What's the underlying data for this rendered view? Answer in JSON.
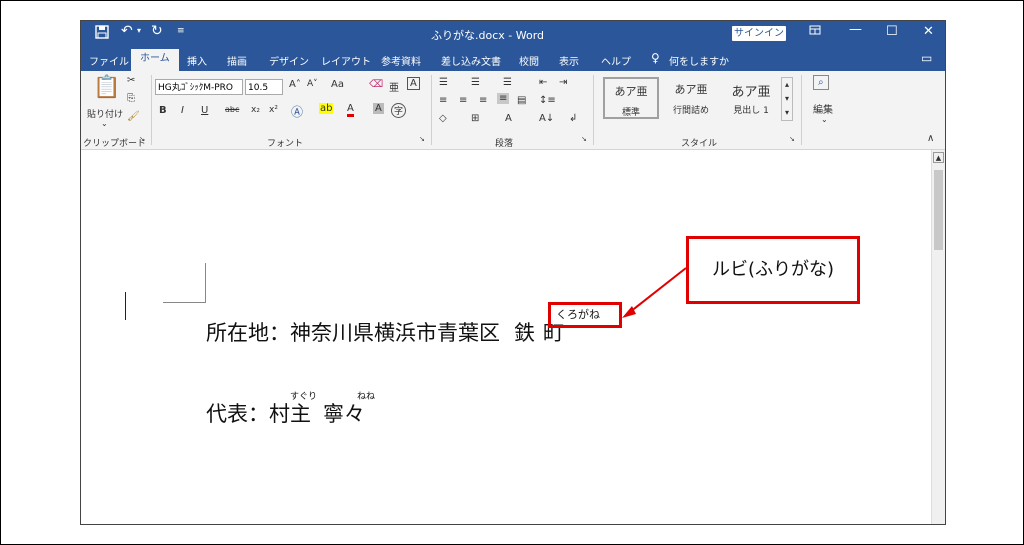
{
  "window": {
    "title": "ふりがな.docx  -  Word",
    "signin_label": "サインイン",
    "icons": [
      "save-icon",
      "undo-icon",
      "redo-icon",
      "customize-icon",
      "ribbon-display-icon",
      "minimize-icon",
      "maximize-icon",
      "close-icon"
    ]
  },
  "tabs": {
    "file": "ファイル",
    "home": "ホーム",
    "insert": "挿入",
    "draw": "描画",
    "design": "デザイン",
    "layout": "レイアウト",
    "references": "参考資料",
    "mailings": "差し込み文書",
    "review": "校閲",
    "view": "表示",
    "help": "ヘルプ",
    "tell_me": "何をしますか"
  },
  "ribbon": {
    "clipboard": {
      "paste_label": "貼り付け",
      "group_label": "クリップボード"
    },
    "font": {
      "font_name": "HG丸ｺﾞｼｯｸM-PRO",
      "font_size": "10.5",
      "bold": "B",
      "italic": "I",
      "underline": "U",
      "strike": "abc",
      "subscript": "x₂",
      "superscript": "x²",
      "case": "Aa",
      "ruby_btn": "亜",
      "border_char": "A",
      "enclose_char": "字",
      "group_label": "フォント"
    },
    "paragraph": {
      "group_label": "段落"
    },
    "styles": {
      "items": [
        {
          "preview": "あア亜",
          "name": "標準"
        },
        {
          "preview": "あア亜",
          "name": "行間詰め"
        },
        {
          "preview": "あア亜",
          "name": "見出し 1"
        }
      ],
      "group_label": "スタイル"
    },
    "editing": {
      "label": "編集"
    }
  },
  "document": {
    "line1": "所在地：神奈川県横浜市青葉区",
    "line1_ruby_word": "鉄",
    "line1_after": "町",
    "line1_ruby": "くろがね",
    "line2_prefix": "代表：",
    "line2_name1": "村主",
    "line2_name2": "寧々",
    "line2_ruby1": "すぐり",
    "line2_ruby2": "ねね"
  },
  "annotation": {
    "callout_text": "ルビ(ふりがな)",
    "color": "#e00000"
  },
  "colors": {
    "accent": "#2b579a",
    "ribbon_bg": "#f3f3f3"
  }
}
